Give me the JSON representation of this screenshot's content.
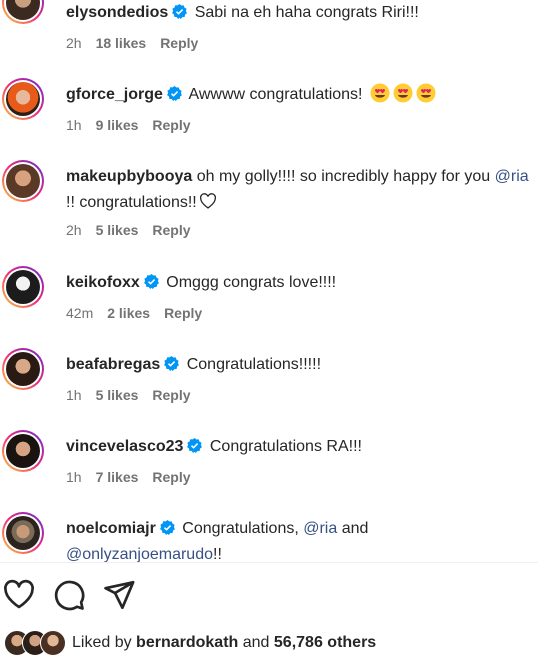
{
  "comments": [
    {
      "username": "elysondedios",
      "text": "Sabi na eh haha congrats Riri!!!",
      "time": "2h",
      "likes": "18 likes",
      "reply": "Reply"
    },
    {
      "username": "gforce_jorge",
      "text": "Awwww congratulations!",
      "time": "1h",
      "likes": "9 likes",
      "reply": "Reply"
    },
    {
      "username": "makeupbybooya",
      "text_a": "oh my golly!!!! so incredibly happy for you",
      "mention": "@ria",
      "text_b": "!! congratulations!!",
      "time": "2h",
      "likes": "5 likes",
      "reply": "Reply"
    },
    {
      "username": "keikofoxx",
      "text": "Omggg congrats love!!!!",
      "time": "42m",
      "likes": "2 likes",
      "reply": "Reply"
    },
    {
      "username": "beafabregas",
      "text": "Congratulations!!!!!",
      "time": "1h",
      "likes": "5 likes",
      "reply": "Reply"
    },
    {
      "username": "vincevelasco23",
      "text": "Congratulations RA!!!",
      "time": "1h",
      "likes": "7 likes",
      "reply": "Reply"
    },
    {
      "username": "noelcomiajr",
      "text_a": "Congratulations,",
      "mention1": "@ria",
      "text_b": "and",
      "mention2": "@onlyzanjoemarudo",
      "text_c": "!!"
    }
  ],
  "likes_summary": {
    "prefix": "Liked by",
    "user": "bernardokath",
    "joiner": "and",
    "count": "56,786 others"
  },
  "icons": [
    "verified-badge-icon",
    "heart-eyes-emoji-icon",
    "heart-outline-icon",
    "comment-icon",
    "share-icon"
  ],
  "colors": {
    "verified": "#0095f6",
    "mention": "#385185",
    "meta": "#737373",
    "text": "#262626"
  }
}
